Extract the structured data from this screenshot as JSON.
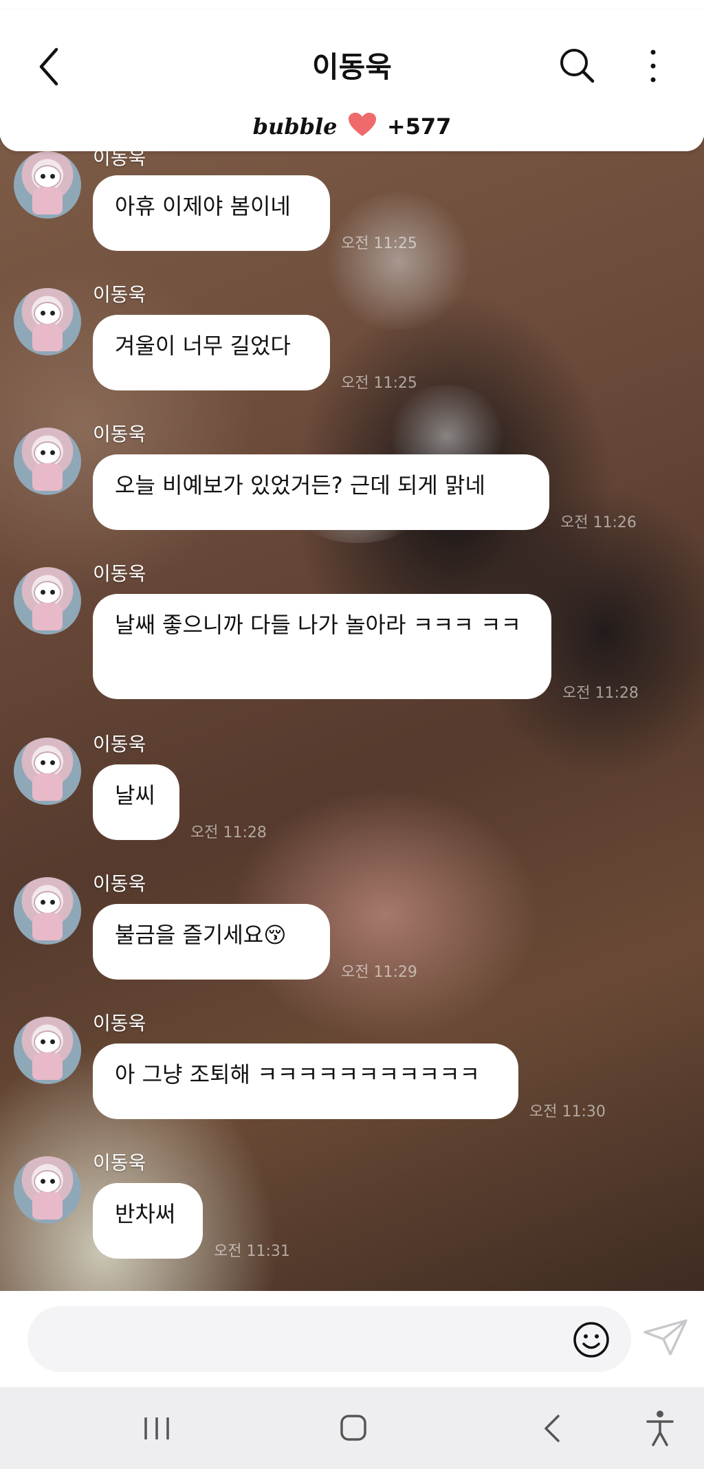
{
  "header": {
    "title": "이동욱",
    "bubble_logo": "bubble",
    "bubble_count": "+577"
  },
  "messages": [
    {
      "sender": "이동욱",
      "text": "아휴 이제야 봄이네",
      "time": "오전 11:25"
    },
    {
      "sender": "이동욱",
      "text": "겨울이 너무 길었다",
      "time": "오전 11:25"
    },
    {
      "sender": "이동욱",
      "text": "오늘 비예보가 있었거든? 근데 되게 맑네",
      "time": "오전 11:26"
    },
    {
      "sender": "이동욱",
      "text": "날쌔 좋으니까 다들 나가 놀아라 ㅋㅋㅋ ㅋㅋ",
      "time": "오전 11:28"
    },
    {
      "sender": "이동욱",
      "text": "날씨",
      "time": "오전 11:28"
    },
    {
      "sender": "이동욱",
      "text": "불금을 즐기세요😚",
      "time": "오전 11:29"
    },
    {
      "sender": "이동욱",
      "text": "아 그냥 조퇴해 ㅋㅋㅋㅋㅋㅋㅋㅋㅋㅋㅋ",
      "time": "오전 11:30"
    },
    {
      "sender": "이동욱",
      "text": "반차써",
      "time": "오전 11:31"
    }
  ],
  "input": {
    "placeholder": ""
  },
  "icons": {
    "back": "back-arrow-icon",
    "search": "search-icon",
    "more": "more-vertical-icon",
    "heart": "heart-icon",
    "emoji": "smiley-icon",
    "send": "send-icon",
    "nav_recents": "recents-icon",
    "nav_home": "home-icon",
    "nav_back": "nav-back-icon",
    "nav_accessibility": "accessibility-icon"
  },
  "colors": {
    "heart": "#ef6b6b",
    "bubble_bg": "#ffffff",
    "header_bg": "#ffffff",
    "navbar_bg": "#eeeef0"
  }
}
